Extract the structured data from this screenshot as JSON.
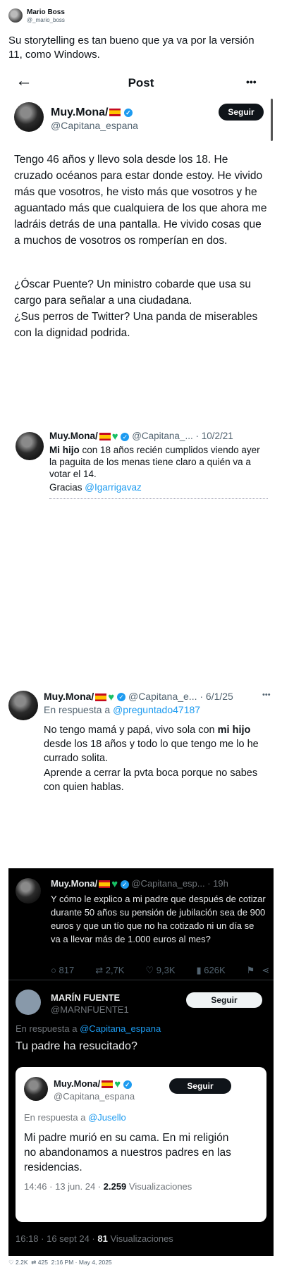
{
  "header": {
    "name": "Mario Boss",
    "handle": "@_mario_boss",
    "text": "Su storytelling es tan bueno que ya va por la versión 11, como Windows."
  },
  "post_view": {
    "title": "Post",
    "more": "•••",
    "follow": "Seguir",
    "name": "Muy.Mona/",
    "handle": "@Capitana_espana",
    "para1": "Tengo 46 años y llevo sola desde los 18. He cruzado océanos para estar donde estoy. He vivido más que vosotros, he visto más que vosotros y he aguantado más que cualquiera de los que ahora me ladráis detrás de una pantalla. He vivido cosas que a muchos de vosotros os romperían en dos.",
    "para2": "¿Óscar Puente? Un ministro cobarde que usa su cargo para señalar a una ciudadana.",
    "para3": "¿Sus perros de Twitter? Una panda de miserables con la dignidad podrida."
  },
  "tweet2": {
    "name": "Muy.Mona/",
    "handle_date": "@Capitana_... · 10/2/21",
    "bold": "Mi hijo",
    "text": " con 18 años recién cumplidos viendo ayer la paguita de los menas tiene claro a quién va a votar el 14.",
    "gracias": "Gracias ",
    "mention": "@Igarrigavaz"
  },
  "tweet3": {
    "name": "Muy.Mona/",
    "handle_date": "@Capitana_e... · 6/1/25",
    "more": "•••",
    "reply_prefix": "En respuesta a ",
    "reply_to": "@preguntado47187",
    "line_a": "No tengo mamá y papá, vivo sola con ",
    "bold": "mi hijo",
    "line_b": " desde los 18 años y todo lo que tengo me lo he currado solita.",
    "line_c": "Aprende a cerrar la pvta boca porque no sabes con quien hablas."
  },
  "dark_block": {
    "t1_name": "Muy.Mona/",
    "t1_handle": "@Capitana_esp... · 19h",
    "t1_text": "Y cómo le explico a mi padre que después de cotizar durante 50 años su pensión de jubilación sea de 900 euros y que un tío que no ha cotizado ni un día se va a llevar más de 1.000 euros al mes?",
    "stats": [
      "817",
      "2,7K",
      "9,3K",
      "626K"
    ],
    "r_name": "MARÍN FUENTE",
    "r_handle": "@MARNFUENTE1",
    "r_follow": "Seguir",
    "r_prefix": "En respuesta a ",
    "r_to": "@Capitana_espana",
    "r_text": "Tu padre ha resucitado?",
    "r_time": "16:18 · 16 sept 24 · ",
    "r_views": "81",
    "r_views_label": " Visualizaciones"
  },
  "quoted": {
    "name": "Muy.Mona/",
    "handle": "@Capitana_espana",
    "follow": "Seguir",
    "reply_prefix": "En respuesta a ",
    "reply_to": "@Jusello",
    "text": "Mi padre murió en su cama. En mi religión no abandonamos a nuestros padres en las residencias.",
    "time": "14:46 · 13 jun. 24 · ",
    "views": "2.259",
    "views_label": " Visualizaciones"
  },
  "footer": {
    "likes": "2.2K",
    "retweets": "425",
    "time": "2:16 PM · May 4, 2025"
  },
  "colors": {
    "accent": "#1d9bf0",
    "dark_bg": "#000000",
    "card_bg": "#ffffff"
  }
}
